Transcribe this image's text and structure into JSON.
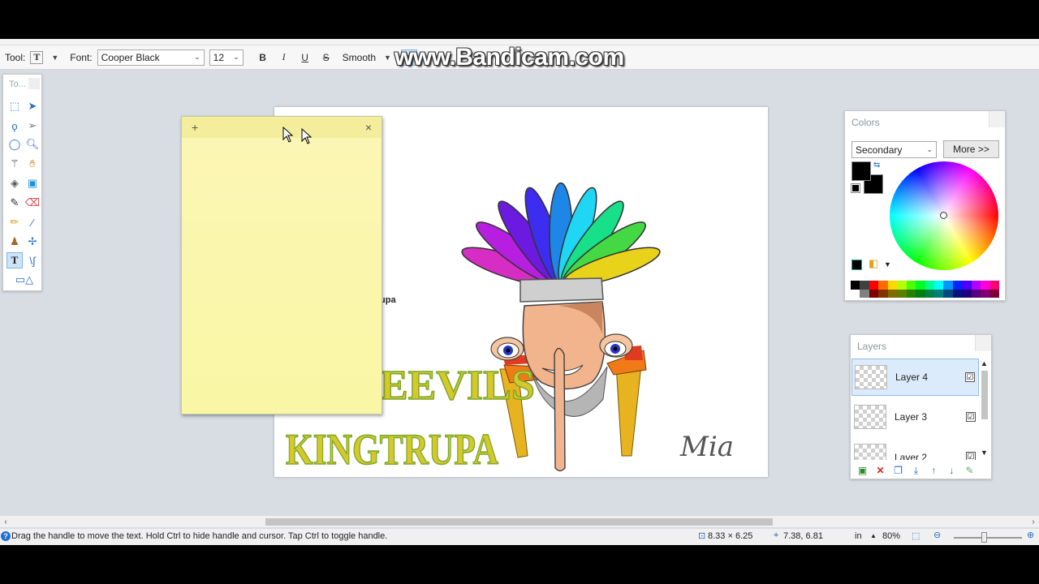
{
  "toolbar": {
    "tool_label": "Tool:",
    "font_label": "Font:",
    "font_value": "Cooper Black",
    "size_value": "12",
    "bold": "B",
    "italic": "I",
    "underline": "U",
    "strike": "S",
    "antialias": "Smooth"
  },
  "watermark": "www.Bandicam.com",
  "tools_panel": {
    "title": "To..."
  },
  "canvas": {
    "title_fragment": "upa",
    "text_line1": "EEVILS",
    "text_line2": "KINGTRUPA",
    "signature": "Mia",
    "feather_colors": [
      "#d62ec4",
      "#b61ee0",
      "#6c1ae0",
      "#3c2df0",
      "#1d86e6",
      "#1fd6f4",
      "#17e088",
      "#45d845",
      "#e8d21a"
    ]
  },
  "note": {
    "add": "+",
    "close": "×"
  },
  "colors_panel": {
    "title": "Colors",
    "mode": "Secondary",
    "more_button": "More >>",
    "primary": "#000000",
    "secondary": "#000000",
    "palette": [
      "#000000",
      "#404040",
      "#ff0000",
      "#ff6a00",
      "#ffd800",
      "#b6ff00",
      "#4cff00",
      "#00ff21",
      "#00ff90",
      "#00ffff",
      "#0094ff",
      "#0026ff",
      "#4800ff",
      "#b200ff",
      "#ff00dc",
      "#ff006e",
      "#ffffff",
      "#808080",
      "#7f0000",
      "#7f3300",
      "#7f6a00",
      "#5b7f00",
      "#267f00",
      "#007f0e",
      "#007f46",
      "#007f7f",
      "#004a7f",
      "#00137f",
      "#21007f",
      "#57007f",
      "#7f006e",
      "#7f0037"
    ]
  },
  "layers_panel": {
    "title": "Layers",
    "layers": [
      {
        "name": "Layer 4",
        "visible": "☑"
      },
      {
        "name": "Layer 3",
        "visible": "☑"
      },
      {
        "name": "Layer 2",
        "visible": "☑"
      }
    ]
  },
  "status": {
    "message": "Drag the handle to move the text. Hold Ctrl to hide handle and cursor. Tap Ctrl to toggle handle.",
    "size": "8.33 × 6.25",
    "position": "7.38, 6.81",
    "unit": "in",
    "zoom": "80%"
  }
}
